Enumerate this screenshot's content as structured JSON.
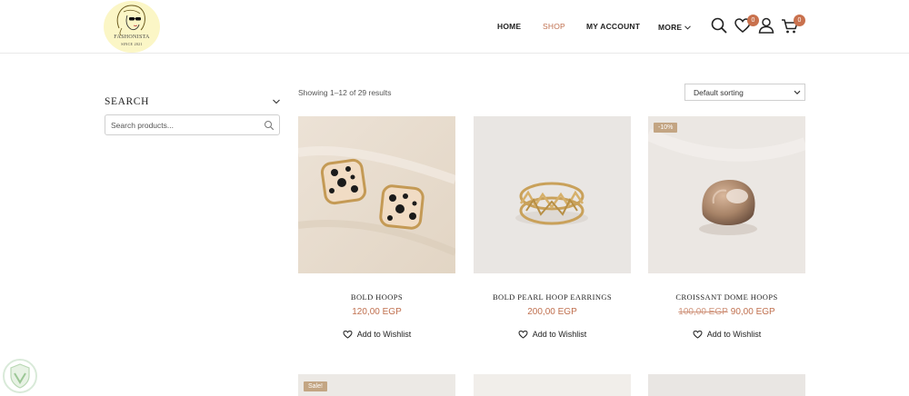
{
  "brand": {
    "name": "FASHONISTA",
    "since": "SINCE 2021"
  },
  "nav": {
    "home": "HOME",
    "shop": "SHOP",
    "account": "MY ACCOUNT",
    "more": "MORE"
  },
  "badges": {
    "wishlist_count": "0",
    "cart_count": "0"
  },
  "colors": {
    "accent": "#c0704f",
    "badge": "#c9714d",
    "logo_bg": "#fbf6c6",
    "tag": "#c3a583"
  },
  "sidebar": {
    "search_title": "SEARCH",
    "search_placeholder": "Search products..."
  },
  "toolbar": {
    "result_count": "Showing 1–12 of 29 results",
    "sort_selected": "Default sorting"
  },
  "products": [
    {
      "name": "BOLD HOOPS",
      "price": "120,00 EGP",
      "old_price": "",
      "tag": "",
      "wishlist_label": "Add to Wishlist"
    },
    {
      "name": "BOLD PEARL HOOP EARRINGS",
      "price": "200,00 EGP",
      "old_price": "",
      "tag": "",
      "wishlist_label": "Add to Wishlist"
    },
    {
      "name": "CROISSANT DOME HOOPS",
      "price": "90,00 EGP",
      "old_price": "100,00 EGP",
      "tag": "-10%",
      "wishlist_label": "Add to Wishlist"
    }
  ],
  "row2": [
    {
      "tag": "Sale!"
    },
    {
      "tag": ""
    },
    {
      "tag": ""
    }
  ]
}
